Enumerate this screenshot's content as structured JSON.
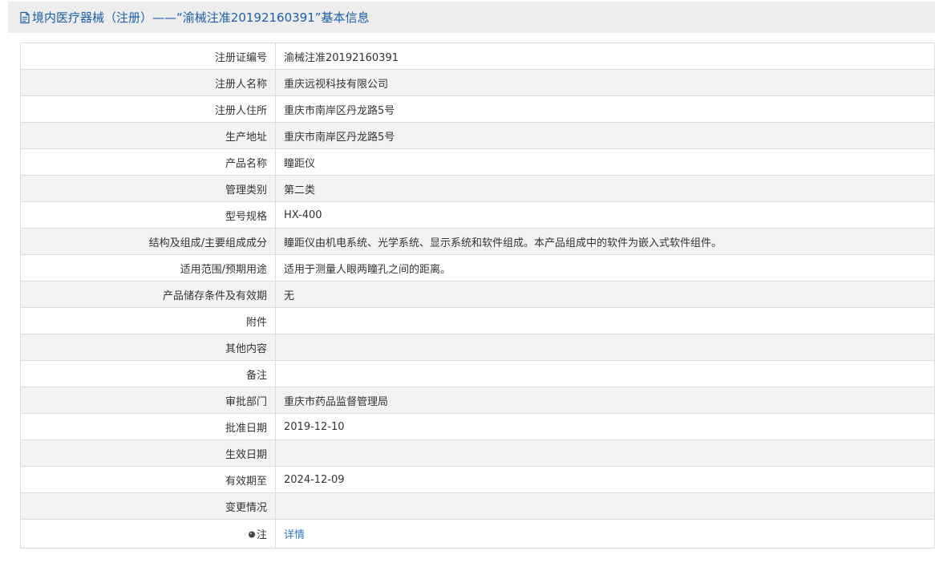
{
  "header": {
    "title": "境内医疗器械（注册）——“渝械注准20192160391”基本信息"
  },
  "fields": [
    {
      "label": "注册证编号",
      "value": "渝械注准20192160391"
    },
    {
      "label": "注册人名称",
      "value": "重庆远视科技有限公司"
    },
    {
      "label": "注册人住所",
      "value": "重庆市南岸区丹龙路5号"
    },
    {
      "label": "生产地址",
      "value": "重庆市南岸区丹龙路5号"
    },
    {
      "label": "产品名称",
      "value": "瞳距仪"
    },
    {
      "label": "管理类别",
      "value": "第二类"
    },
    {
      "label": "型号规格",
      "value": "HX-400"
    },
    {
      "label": "结构及组成/主要组成成分",
      "value": "瞳距仪由机电系统、光学系统、显示系统和软件组成。本产品组成中的软件为嵌入式软件组件。"
    },
    {
      "label": "适用范围/预期用途",
      "value": "适用于测量人眼两瞳孔之间的距离。"
    },
    {
      "label": "产品储存条件及有效期",
      "value": "无"
    },
    {
      "label": "附件",
      "value": ""
    },
    {
      "label": "其他内容",
      "value": ""
    },
    {
      "label": "备注",
      "value": ""
    },
    {
      "label": "审批部门",
      "value": "重庆市药品监督管理局"
    },
    {
      "label": "批准日期",
      "value": "2019-12-10"
    },
    {
      "label": "生效日期",
      "value": ""
    },
    {
      "label": "有效期至",
      "value": "2024-12-09"
    },
    {
      "label": "变更情况",
      "value": ""
    }
  ],
  "note": {
    "label": "注",
    "link_text": "详情"
  }
}
